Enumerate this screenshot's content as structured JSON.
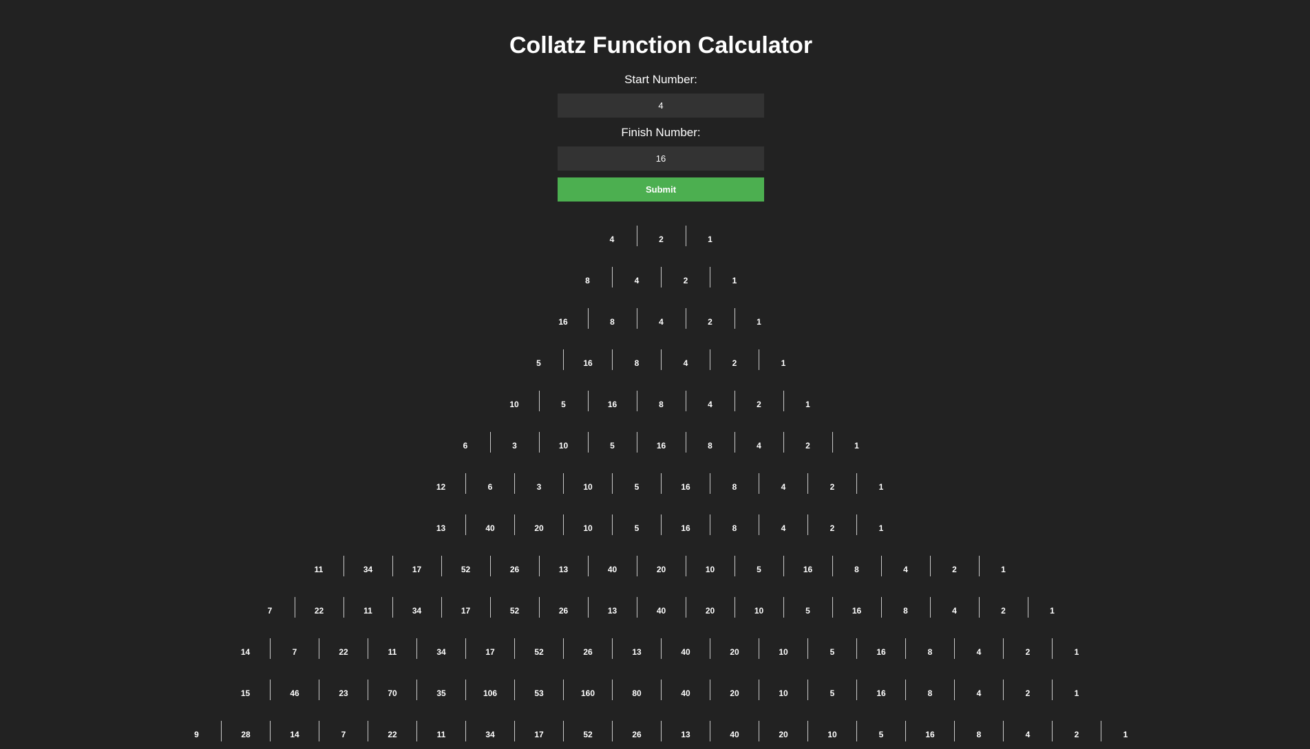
{
  "page": {
    "title": "Collatz Function Calculator"
  },
  "form": {
    "start_label": "Start Number:",
    "start_value": "4",
    "finish_label": "Finish Number:",
    "finish_value": "16",
    "submit_label": "Submit"
  },
  "sequences": [
    [
      4,
      2,
      1
    ],
    [
      8,
      4,
      2,
      1
    ],
    [
      16,
      8,
      4,
      2,
      1
    ],
    [
      5,
      16,
      8,
      4,
      2,
      1
    ],
    [
      10,
      5,
      16,
      8,
      4,
      2,
      1
    ],
    [
      6,
      3,
      10,
      5,
      16,
      8,
      4,
      2,
      1
    ],
    [
      12,
      6,
      3,
      10,
      5,
      16,
      8,
      4,
      2,
      1
    ],
    [
      13,
      40,
      20,
      10,
      5,
      16,
      8,
      4,
      2,
      1
    ],
    [
      11,
      34,
      17,
      52,
      26,
      13,
      40,
      20,
      10,
      5,
      16,
      8,
      4,
      2,
      1
    ],
    [
      7,
      22,
      11,
      34,
      17,
      52,
      26,
      13,
      40,
      20,
      10,
      5,
      16,
      8,
      4,
      2,
      1
    ],
    [
      14,
      7,
      22,
      11,
      34,
      17,
      52,
      26,
      13,
      40,
      20,
      10,
      5,
      16,
      8,
      4,
      2,
      1
    ],
    [
      15,
      46,
      23,
      70,
      35,
      106,
      53,
      160,
      80,
      40,
      20,
      10,
      5,
      16,
      8,
      4,
      2,
      1
    ],
    [
      9,
      28,
      14,
      7,
      22,
      11,
      34,
      17,
      52,
      26,
      13,
      40,
      20,
      10,
      5,
      16,
      8,
      4,
      2,
      1
    ]
  ]
}
